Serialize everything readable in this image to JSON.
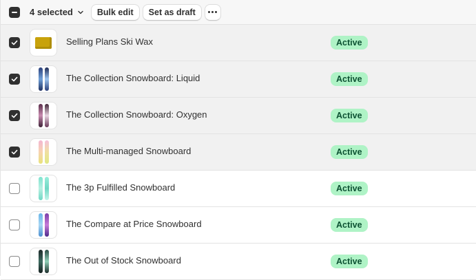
{
  "bulk_bar": {
    "selected_label": "4 selected",
    "bulk_edit_label": "Bulk edit",
    "set_draft_label": "Set as draft"
  },
  "products": [
    {
      "title": "Selling Plans Ski Wax",
      "status": "Active",
      "selected": true,
      "thumb": "wax"
    },
    {
      "title": "The Collection Snowboard: Liquid",
      "status": "Active",
      "selected": true,
      "thumb": "snowboard"
    },
    {
      "title": "The Collection Snowboard: Oxygen",
      "status": "Active",
      "selected": true,
      "thumb": "snowboard"
    },
    {
      "title": "The Multi-managed Snowboard",
      "status": "Active",
      "selected": true,
      "thumb": "snowboard"
    },
    {
      "title": "The 3p Fulfilled Snowboard",
      "status": "Active",
      "selected": false,
      "thumb": "snowboard"
    },
    {
      "title": "The Compare at Price Snowboard",
      "status": "Active",
      "selected": false,
      "thumb": "snowboard"
    },
    {
      "title": "The Out of Stock Snowboard",
      "status": "Active",
      "selected": false,
      "thumb": "snowboard"
    }
  ],
  "colors": {
    "badge_bg": "#aff3c6",
    "badge_text": "#0c5132",
    "selected_row_bg": "#f1f1f1",
    "checkbox_checked": "#303030"
  }
}
